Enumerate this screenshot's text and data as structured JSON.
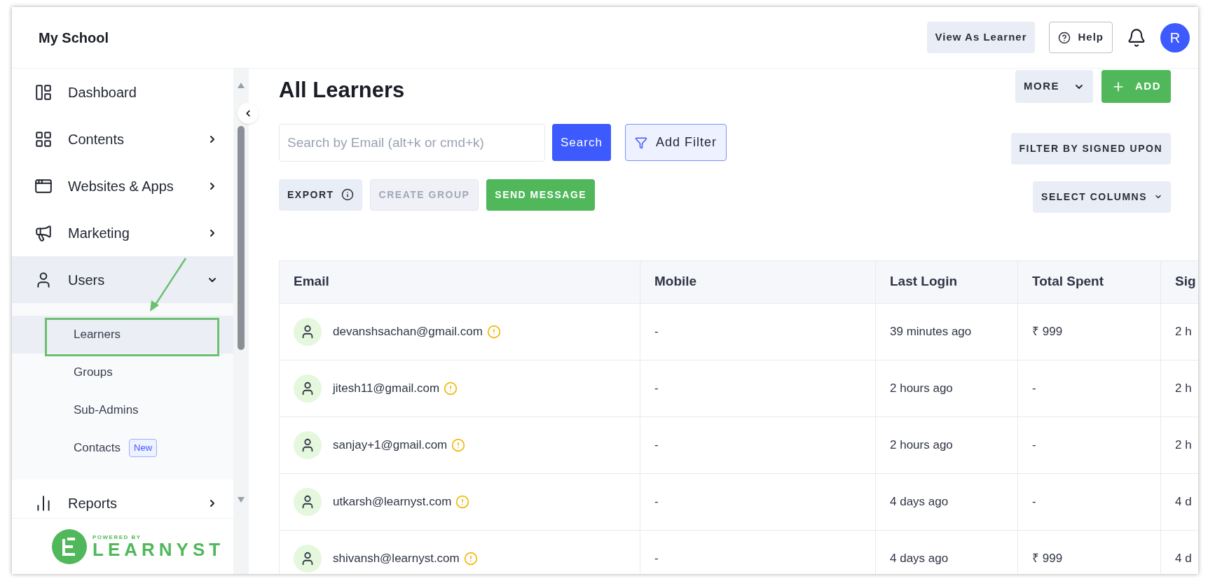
{
  "header": {
    "title": "My School",
    "view_as_learner": "View As Learner",
    "help": "Help",
    "avatar": "R"
  },
  "sidebar": {
    "items": [
      {
        "label": "Dashboard",
        "has_arrow": false,
        "expanded": false,
        "selected": false
      },
      {
        "label": "Contents",
        "has_arrow": true,
        "expanded": false,
        "selected": false
      },
      {
        "label": "Websites & Apps",
        "has_arrow": true,
        "expanded": false,
        "selected": false
      },
      {
        "label": "Marketing",
        "has_arrow": true,
        "expanded": false,
        "selected": false
      },
      {
        "label": "Users",
        "has_arrow": true,
        "expanded": true,
        "selected": true,
        "children": [
          {
            "label": "Learners",
            "selected": true
          },
          {
            "label": "Groups",
            "selected": false
          },
          {
            "label": "Sub-Admins",
            "selected": false
          },
          {
            "label": "Contacts",
            "selected": false,
            "badge": "New"
          }
        ]
      },
      {
        "label": "Reports",
        "has_arrow": true,
        "expanded": false,
        "selected": false
      }
    ],
    "footer": {
      "powered_by": "POWERED BY",
      "brand": "LEARNYST"
    }
  },
  "main": {
    "title": "All Learners",
    "more": "MORE",
    "add": "ADD",
    "search": {
      "placeholder": "Search by Email (alt+k or cmd+k)",
      "button": "Search"
    },
    "add_filter": "Add Filter",
    "filter_signed": "FILTER BY SIGNED UPON",
    "actions": [
      {
        "label": "EXPORT",
        "kind": "info",
        "disabled": false
      },
      {
        "label": "CREATE GROUP",
        "kind": "plain",
        "disabled": true
      },
      {
        "label": "SEND MESSAGE",
        "kind": "primary",
        "disabled": false
      }
    ],
    "select_columns": "SELECT COLUMNS",
    "table": {
      "columns": [
        "Email",
        "Mobile",
        "Last Login",
        "Total Spent",
        "Sig"
      ],
      "rows": [
        [
          "devanshsachan@gmail.com",
          "-",
          "39 minutes ago",
          "₹ 999",
          "2 h"
        ],
        [
          "jitesh11@gmail.com",
          "-",
          "2 hours ago",
          "-",
          "2 h"
        ],
        [
          "sanjay+1@gmail.com",
          "-",
          "2 hours ago",
          "-",
          "2 h"
        ],
        [
          "utkarsh@learnyst.com",
          "-",
          "4 days ago",
          "-",
          "4 d"
        ],
        [
          "shivansh@learnyst.com",
          "-",
          "4 days ago",
          "₹ 999",
          "4 d"
        ]
      ]
    }
  }
}
